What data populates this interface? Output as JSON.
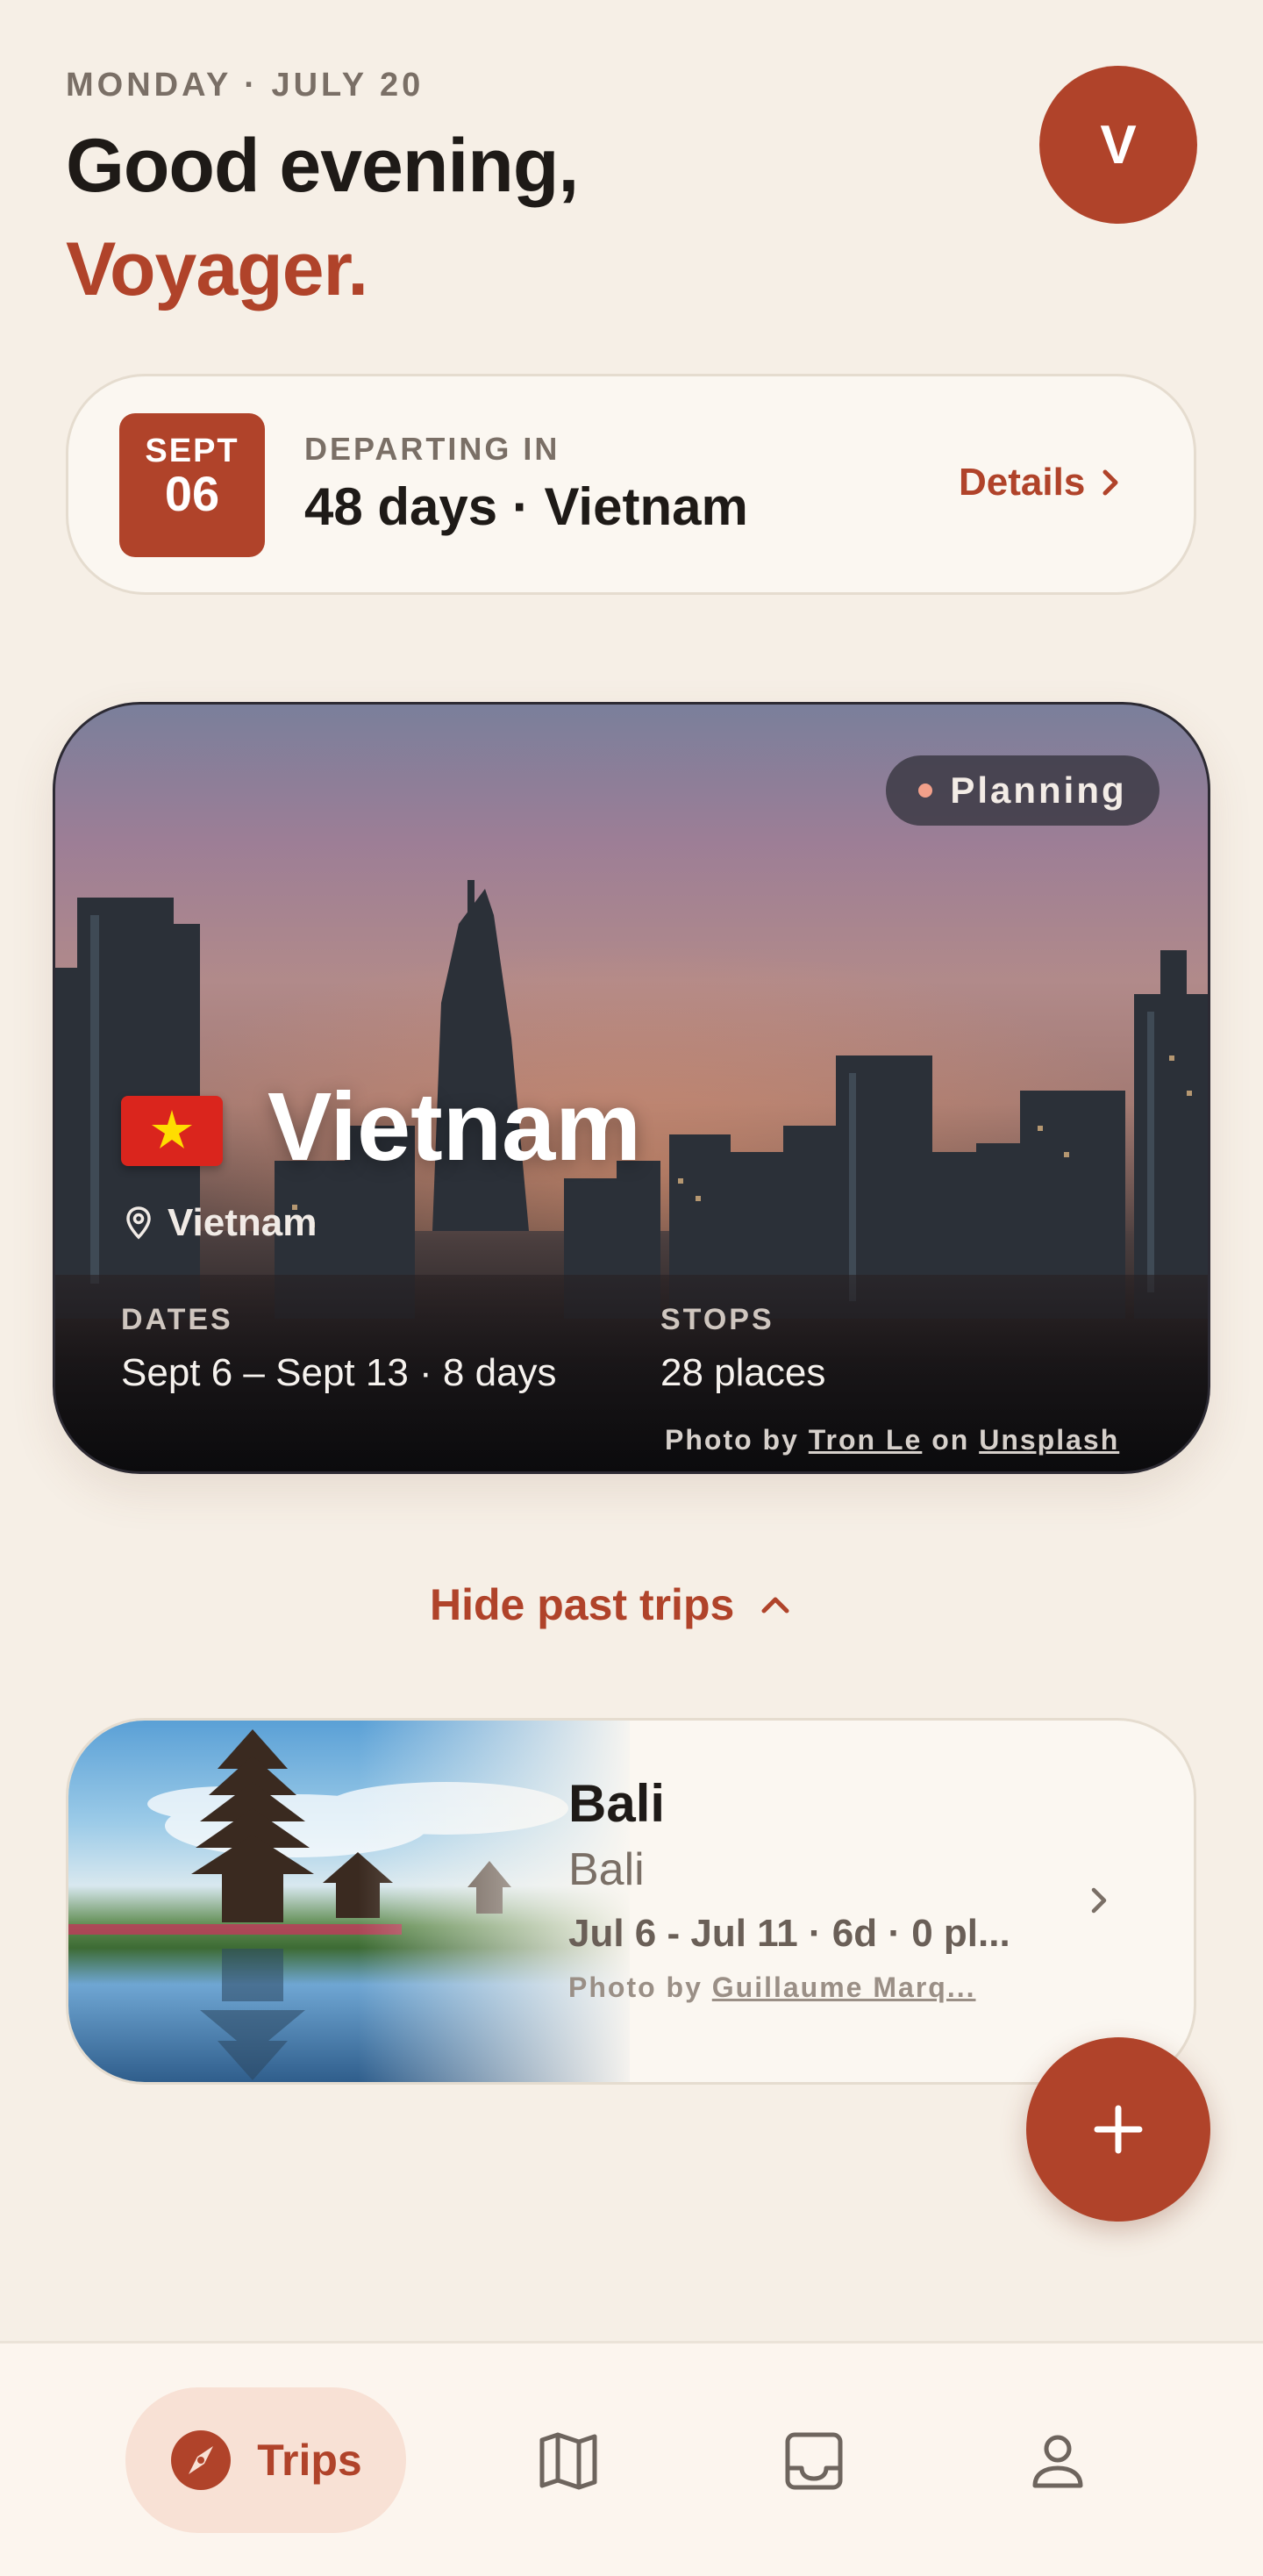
{
  "header": {
    "date_line": "MONDAY · JULY 20",
    "greeting": "Good evening,",
    "name": "Voyager.",
    "avatar_initial": "V"
  },
  "countdown": {
    "month": "SEPT",
    "day": "06",
    "label": "DEPARTING IN",
    "value": "48 days · Vietnam",
    "details_label": "Details"
  },
  "featured_trip": {
    "status": "Planning",
    "title": "Vietnam",
    "location": "Vietnam",
    "dates_label": "DATES",
    "dates_value": "Sept 6 – Sept 13 · 8 days",
    "stops_label": "STOPS",
    "stops_value": "28 places",
    "credit_prefix": "Photo by",
    "credit_author": "Tron Le",
    "credit_mid": "on",
    "credit_source": "Unsplash",
    "flag": "vietnam-flag-icon"
  },
  "past_toggle": {
    "label": "Hide past trips"
  },
  "past_trips": [
    {
      "name": "Bali",
      "location": "Bali",
      "info": "Jul 6 - Jul 11 · 6d · 0 pl...",
      "credit_prefix": "Photo by",
      "credit_author": "Guillaume Marq..."
    }
  ],
  "fab": {
    "icon": "plus-icon"
  },
  "nav": {
    "items": [
      {
        "label": "Trips",
        "icon": "compass-icon",
        "active": true
      },
      {
        "label": "",
        "icon": "map-icon",
        "active": false
      },
      {
        "label": "",
        "icon": "inbox-icon",
        "active": false
      },
      {
        "label": "",
        "icon": "profile-icon",
        "active": false
      }
    ]
  },
  "colors": {
    "background": "#f6efe6",
    "accent": "#b0432a",
    "card": "#fbf7f1",
    "nav_active_bg": "#f8e1d5"
  }
}
